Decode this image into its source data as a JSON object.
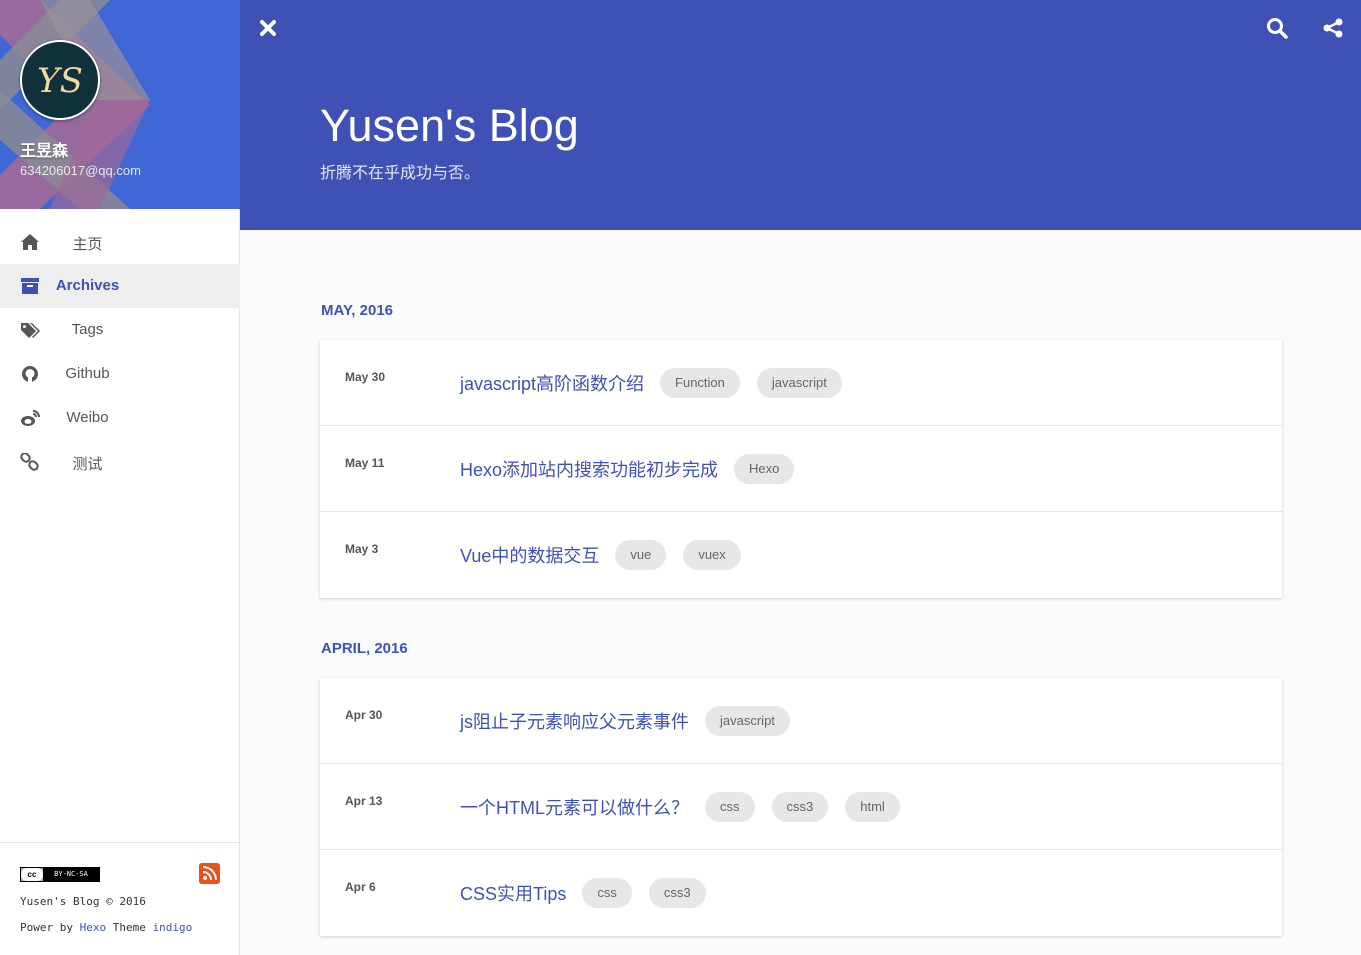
{
  "profile": {
    "name": "王昱森",
    "email": "634206017@qq.com",
    "avatar_text": "YS"
  },
  "nav": [
    {
      "label": "主页",
      "icon": "home-icon"
    },
    {
      "label": "Archives",
      "icon": "archive-icon",
      "active": true
    },
    {
      "label": "Tags",
      "icon": "tags-icon"
    },
    {
      "label": "Github",
      "icon": "github-icon"
    },
    {
      "label": "Weibo",
      "icon": "weibo-icon"
    },
    {
      "label": "测试",
      "icon": "link-icon"
    }
  ],
  "footer": {
    "license_badge": "BY-NC-SA",
    "license_symbol": "cc",
    "copyright": "Yusen's Blog © 2016",
    "power_prefix": "Power by",
    "hexo": "Hexo",
    "theme_prefix": "Theme",
    "theme": "indigo"
  },
  "header": {
    "title": "Yusen's Blog",
    "subtitle": "折腾不在乎成功与否。"
  },
  "archives": [
    {
      "month": "MAY, 2016",
      "posts": [
        {
          "date": "May 30",
          "title": "javascript高阶函数介绍",
          "tags": [
            "Function",
            "javascript"
          ]
        },
        {
          "date": "May 11",
          "title": "Hexo添加站内搜索功能初步完成",
          "tags": [
            "Hexo"
          ]
        },
        {
          "date": "May 3",
          "title": "Vue中的数据交互",
          "tags": [
            "vue",
            "vuex"
          ]
        }
      ]
    },
    {
      "month": "APRIL, 2016",
      "posts": [
        {
          "date": "Apr 30",
          "title": "js阻止子元素响应父元素事件",
          "tags": [
            "javascript"
          ]
        },
        {
          "date": "Apr 13",
          "title": "一个HTML元素可以做什么？",
          "tags": [
            "css",
            "css3",
            "html"
          ]
        },
        {
          "date": "Apr 6",
          "title": "CSS实用Tips",
          "tags": [
            "css",
            "css3"
          ]
        }
      ]
    }
  ],
  "colors": {
    "primary": "#3f51b5",
    "tag_bg": "#e7e7e7",
    "rss": "#e9521f"
  }
}
